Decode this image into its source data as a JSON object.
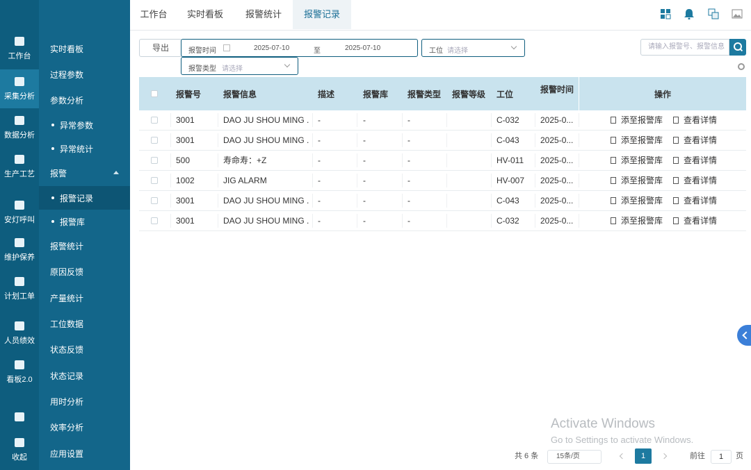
{
  "rail": {
    "items": [
      {
        "label": "工作台",
        "icon": "workbench-icon"
      },
      {
        "label": "采集分析",
        "icon": "collection-icon"
      },
      {
        "label": "数据分析",
        "icon": "chart-icon"
      },
      {
        "label": "生产工艺",
        "icon": "folder-icon"
      },
      {
        "label": "安灯呼叫",
        "icon": "andon-icon"
      },
      {
        "label": "维护保养",
        "icon": "tools-icon"
      },
      {
        "label": "计划工单",
        "icon": "clipboard-icon"
      },
      {
        "label": "人员绩效",
        "icon": "person-icon"
      },
      {
        "label": "看板2.0",
        "icon": "board-icon"
      },
      {
        "label": "",
        "icon": "bars-icon"
      },
      {
        "label": "收起",
        "icon": "collapse-icon"
      }
    ]
  },
  "subnav": {
    "items": [
      {
        "label": "实时看板",
        "child": false
      },
      {
        "label": "过程参数",
        "child": false
      },
      {
        "label": "参数分析",
        "child": false
      },
      {
        "label": "异常参数",
        "child": true
      },
      {
        "label": "异常统计",
        "child": true
      },
      {
        "label": "报警",
        "child": false,
        "expanded": true
      },
      {
        "label": "报警记录",
        "child": true,
        "active": true
      },
      {
        "label": "报警库",
        "child": true
      },
      {
        "label": "报警统计",
        "child": false
      },
      {
        "label": "原因反馈",
        "child": false
      },
      {
        "label": "产量统计",
        "child": false
      },
      {
        "label": "工位数据",
        "child": false
      },
      {
        "label": "状态反馈",
        "child": false
      },
      {
        "label": "状态记录",
        "child": false
      },
      {
        "label": "用时分析",
        "child": false
      },
      {
        "label": "效率分析",
        "child": false
      },
      {
        "label": "应用设置",
        "child": false
      }
    ]
  },
  "tabs": [
    "工作台",
    "实时看板",
    "报警统计",
    "报警记录"
  ],
  "filters": {
    "export_label": "导出",
    "date_label": "报警时间",
    "date_from": "2025-07-10",
    "date_sep": "至",
    "date_to": "2025-07-10",
    "station_label": "工位",
    "station_placeholder": "请选择",
    "type_label": "报警类型",
    "type_placeholder": "请选择",
    "search_placeholder": "请输入报警号、报警信息"
  },
  "table": {
    "headers": [
      "报警号",
      "报警信息",
      "描述",
      "报警库",
      "报警类型",
      "报警等级",
      "工位",
      "报警时间",
      "操作"
    ],
    "op_add": "添至报警库",
    "op_view": "查看详情",
    "rows": [
      [
        "3001",
        "DAO JU SHOU MING ...",
        "-",
        "-",
        "-",
        "",
        "C-032",
        "2025-0..."
      ],
      [
        "3001",
        "DAO JU SHOU MING ...",
        "-",
        "-",
        "-",
        "",
        "C-043",
        "2025-0..."
      ],
      [
        "500",
        "寿命寿：+Z",
        "-",
        "-",
        "-",
        "",
        "HV-011",
        "2025-0..."
      ],
      [
        "1002",
        "JIG ALARM",
        "-",
        "-",
        "-",
        "",
        "HV-007",
        "2025-0..."
      ],
      [
        "3001",
        "DAO JU SHOU MING ...",
        "-",
        "-",
        "-",
        "",
        "C-043",
        "2025-0..."
      ],
      [
        "3001",
        "DAO JU SHOU MING ...",
        "-",
        "-",
        "-",
        "",
        "C-032",
        "2025-0..."
      ]
    ]
  },
  "pagination": {
    "total": "共 6 条",
    "page_size": "15条/页",
    "current": "1",
    "goto_label": "前往",
    "goto_value": "1",
    "page_unit": "页"
  },
  "watermark": {
    "line1": "Activate Windows",
    "line2": "Go to Settings to activate Windows."
  },
  "colors": {
    "primary": "#0e5d7e",
    "accent": "#1d7aa0",
    "header_bg": "#c9e3ee"
  }
}
